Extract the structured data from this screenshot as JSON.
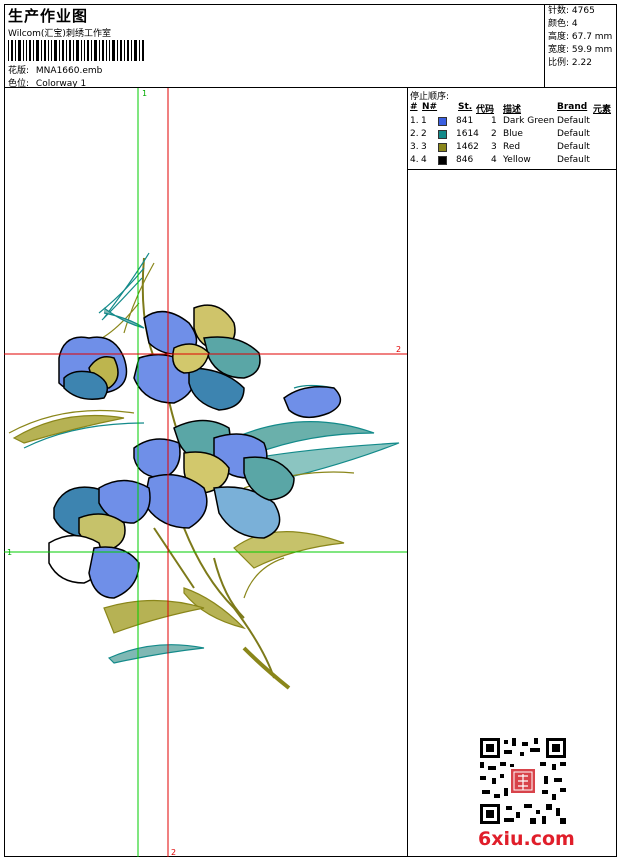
{
  "header": {
    "title": "生产作业图",
    "company": "Wilcom(汇宝)刺绣工作室",
    "design_label": "花版:",
    "design_file": "MNA1660.emb",
    "colorway_label": "色位:",
    "colorway": "Colorway 1"
  },
  "stats": {
    "stitches": "针数: 4765",
    "colors": "颜色: 4",
    "height": "高度: 67.7 mm",
    "width": "宽度: 59.9 mm",
    "scale": "比例: 2.22"
  },
  "stop_sequence": {
    "heading": "停止顺序:",
    "headers": [
      "#",
      "N#",
      "St.",
      "代码",
      "描述",
      "Brand",
      "元素"
    ],
    "rows": [
      {
        "idx": "1.",
        "n": "1",
        "swatch": "#3a5fe0",
        "st": "841",
        "code": "1",
        "desc": "Dark Green",
        "brand": "Default"
      },
      {
        "idx": "2.",
        "n": "2",
        "swatch": "#138a8a",
        "st": "1614",
        "code": "2",
        "desc": "Blue",
        "brand": "Default"
      },
      {
        "idx": "3.",
        "n": "3",
        "swatch": "#8a861a",
        "st": "1462",
        "code": "3",
        "desc": "Red",
        "brand": "Default"
      },
      {
        "idx": "4.",
        "n": "4",
        "swatch": "#000000",
        "st": "846",
        "code": "4",
        "desc": "Yellow",
        "brand": "Default"
      }
    ]
  },
  "guides": {
    "green_v": "1",
    "green_h": "1",
    "red_h": "2",
    "red_v": "2",
    "green_color": "#00cc00",
    "red_color": "#e00000"
  },
  "watermark": {
    "site": "6xiu.com"
  }
}
